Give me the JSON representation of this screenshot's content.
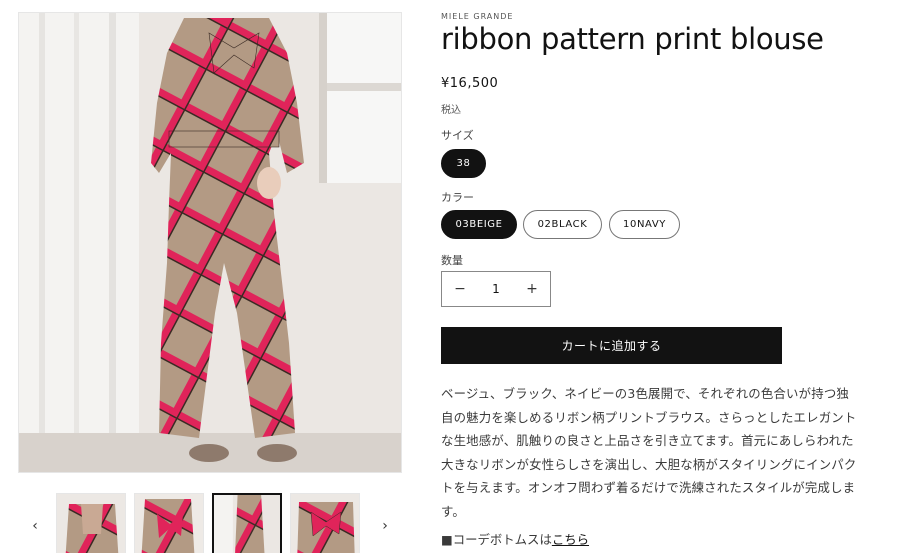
{
  "gallery": {
    "main_image_icon": "product-photo",
    "prev_icon": "‹",
    "next_icon": "›",
    "thumbnails": [
      "thumb-1",
      "thumb-2",
      "thumb-3",
      "thumb-4"
    ],
    "active_thumbnail": 3
  },
  "product": {
    "vendor": "MIELE GRANDE",
    "title": "ribbon pattern print blouse",
    "price": "¥16,500",
    "tax_note": "税込"
  },
  "options": {
    "size_label": "サイズ",
    "sizes": [
      "38"
    ],
    "selected_size": "38",
    "color_label": "カラー",
    "colors": [
      "03BEIGE",
      "02BLACK",
      "10NAVY"
    ],
    "selected_color": "03BEIGE"
  },
  "quantity": {
    "label": "数量",
    "value": "1",
    "minus": "−",
    "plus": "+"
  },
  "cart": {
    "add_label": "カートに追加する"
  },
  "description": {
    "lines": [
      "ベージュ、ブラック、ネイビーの3色展開で、それぞれの色合いが持つ独",
      "自の魅力を楽しめるリボン柄プリントブラウス。さらっとしたエレガント",
      "な生地感が、肌触りの良さと上品さを引き立てます。首元にあしらわれた",
      "大きなリボンが女性らしさを演出し、大胆な柄がスタイリングにインパク",
      "トを与えます。オンオフ問わず着るだけで洗練されたスタイルが完成しま",
      "す。"
    ],
    "coord_prefix": "■コーデボトムスは",
    "coord_link": "こちら"
  },
  "colors": {
    "accent": "#121212",
    "print_pink": "#e0245a",
    "print_beige": "#b39a84"
  }
}
